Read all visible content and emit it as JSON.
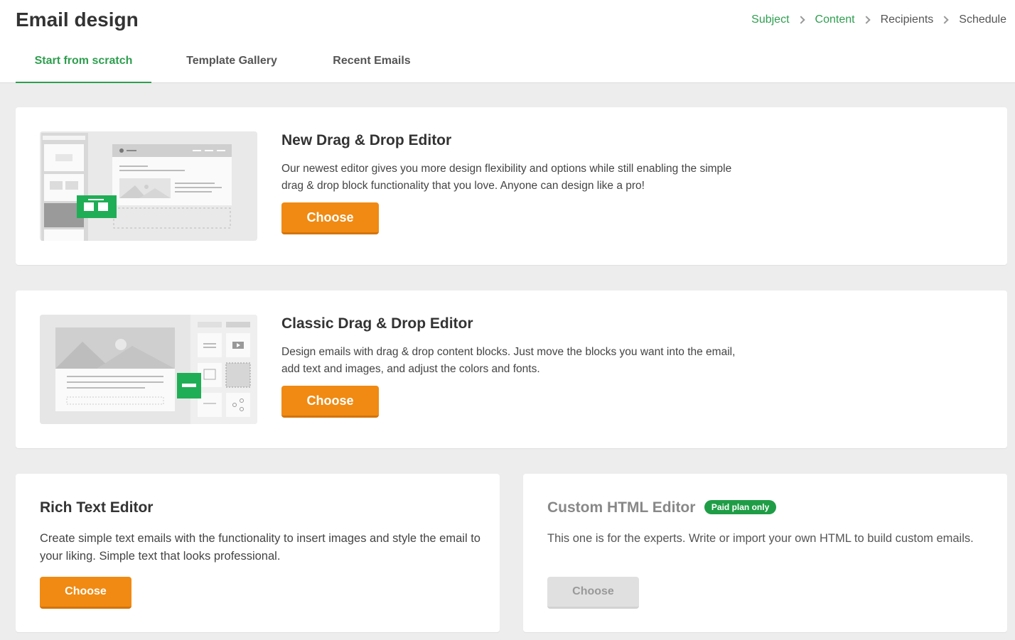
{
  "page": {
    "title": "Email design"
  },
  "steps": [
    "Subject",
    "Content",
    "Recipients",
    "Schedule"
  ],
  "tabs": [
    "Start from scratch",
    "Template Gallery",
    "Recent Emails"
  ],
  "editors": {
    "new_dnd": {
      "title": "New Drag & Drop Editor",
      "description": "Our newest editor gives you more design flexibility and options while still enabling the simple drag & drop block functionality that you love. Anyone can design like a pro!",
      "button": "Choose"
    },
    "classic_dnd": {
      "title": "Classic Drag & Drop Editor",
      "description": "Design emails with drag & drop content blocks. Just move the blocks you want into the email, add text and images, and adjust the colors and fonts.",
      "button": "Choose"
    },
    "rich_text": {
      "title": "Rich Text Editor",
      "description": "Create simple text emails with the functionality to insert images and style the email to your liking. Simple text that looks professional.",
      "button": "Choose"
    },
    "custom_html": {
      "title": "Custom HTML Editor",
      "badge": "Paid plan only",
      "description": "This one is for the experts. Write or import your own HTML to build custom emails.",
      "button": "Choose"
    }
  },
  "colors": {
    "accent_green": "#2e9e4f",
    "button_orange": "#f08a12",
    "badge_green": "#1f9d46"
  }
}
